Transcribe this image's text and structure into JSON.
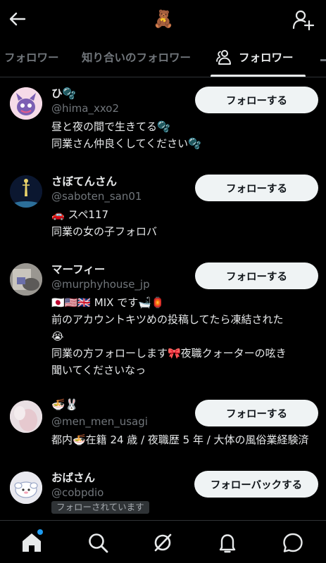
{
  "header": {
    "title_emoji": "🧸",
    "back_icon": "arrow-left-icon",
    "add_user_icon": "person-plus-icon"
  },
  "tabs": [
    {
      "label": "フォロワー",
      "active": false
    },
    {
      "label": "知り合いのフォロワー",
      "active": false
    },
    {
      "label": "フォロワー",
      "active": true,
      "icon": "people-icon"
    }
  ],
  "users": [
    {
      "name": "ひ🫧",
      "handle": "@hima_xxo2",
      "bio": [
        "昼と夜の間で生きてる🫧",
        "同業さん仲良くしてください🫧"
      ],
      "button": "フォローする"
    },
    {
      "name": "さぼてんさん",
      "handle": "@saboten_san01",
      "bio": [
        "🚗 スペ117",
        "同業の女の子フォロバ"
      ],
      "button": "フォローする"
    },
    {
      "name": "マーフィー",
      "handle": "@murphyhouse_jp",
      "bio": [
        "🇯🇵🇺🇸🇬🇧 MIX です🛁🏮",
        "前のアカウントキツめの投稿してたら凍結された",
        "😭",
        "同業の方フォローします🎀夜職クォーターの呟き",
        "聞いてくださいなっ"
      ],
      "button": "フォローする"
    },
    {
      "name": "🍜🐰",
      "handle": "@men_men_usagi",
      "bio": [
        "都内🍜在籍 24 歳 / 夜職歴 5 年 / 大体の風俗業経験済"
      ],
      "button": "フォローする"
    },
    {
      "name": "おばさん",
      "handle": "@cobpdio",
      "badge": "フォローされています",
      "bio": [],
      "button": "フォローバックする"
    }
  ],
  "bottom_nav": [
    {
      "icon": "home-icon",
      "active": true,
      "notification_dot": true
    },
    {
      "icon": "search-icon"
    },
    {
      "icon": "grok-icon"
    },
    {
      "icon": "bell-icon"
    },
    {
      "icon": "message-icon"
    }
  ],
  "colors": {
    "background": "#000000",
    "text": "#e7e9ea",
    "muted": "#71767b",
    "button_bg": "#eff3f4",
    "accent": "#1d9bf0"
  }
}
